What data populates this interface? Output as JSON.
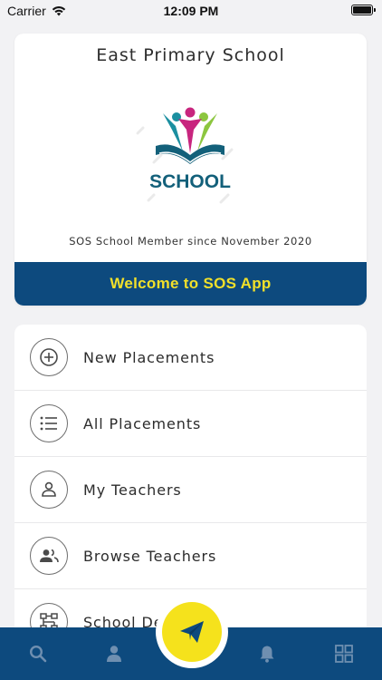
{
  "status_bar": {
    "carrier": "Carrier",
    "time": "12:09 PM"
  },
  "school": {
    "name": "East Primary School",
    "logo_text": "SCHOOL",
    "member_since": "SOS School Member since November 2020",
    "welcome": "Welcome to SOS App"
  },
  "menu": {
    "items": [
      {
        "label": "New Placements",
        "icon": "plus-circle-icon"
      },
      {
        "label": "All Placements",
        "icon": "list-icon"
      },
      {
        "label": "My Teachers",
        "icon": "person-icon"
      },
      {
        "label": "Browse Teachers",
        "icon": "people-icon"
      },
      {
        "label": "School Details",
        "icon": "hierarchy-icon"
      }
    ]
  },
  "bottom_nav": {
    "items": [
      "search-icon",
      "profile-icon",
      "send-icon",
      "bell-icon",
      "grid-icon"
    ]
  },
  "colors": {
    "brand_blue": "#0d4a7e",
    "accent_yellow": "#f5e21c",
    "welcome_text": "#f1e02a",
    "nav_icon": "#6f8fb0"
  }
}
